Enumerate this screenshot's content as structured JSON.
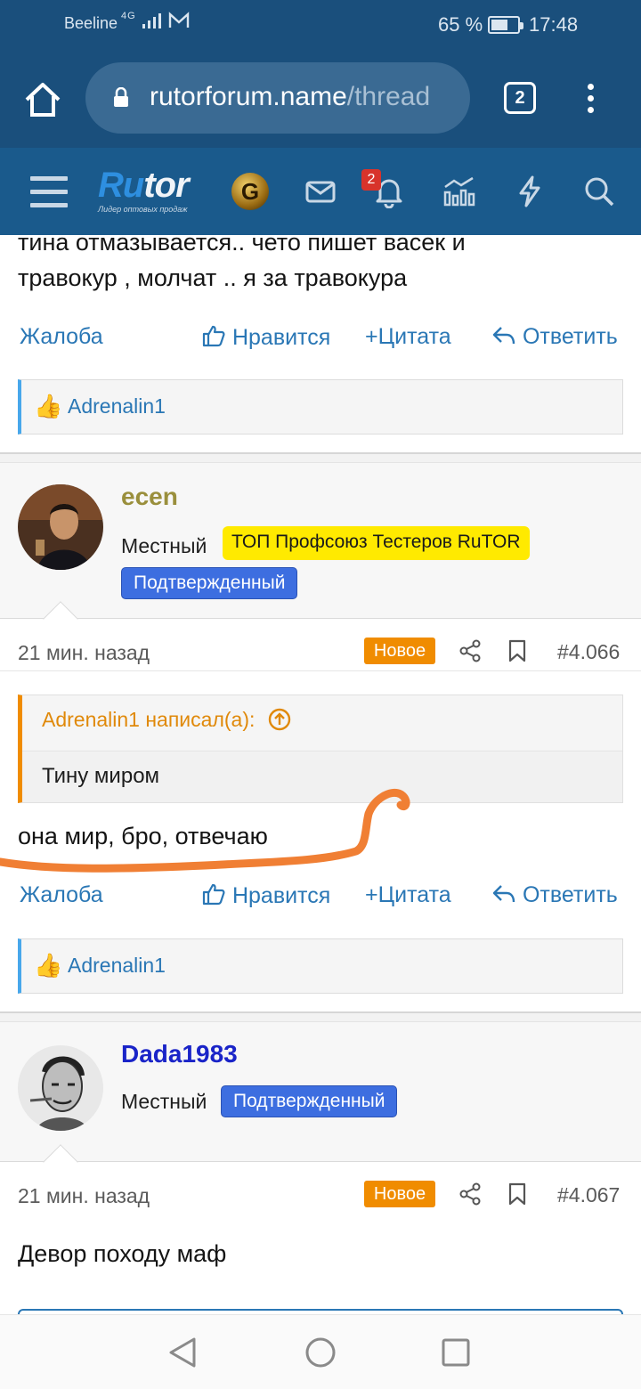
{
  "status_bar": {
    "carrier": "Beeline",
    "network": "4G",
    "battery_percent_text": "65 %",
    "battery_level": 0.65,
    "time": "17:48"
  },
  "browser": {
    "url_host": "rutorforum.name",
    "url_path": "/thread",
    "tab_count": "2"
  },
  "site_header": {
    "logo_text_a": "Ru",
    "logo_text_b": "tor",
    "logo_subtitle": "Лидер оптовых продаж",
    "badge_letter": "G",
    "notification_count": "2",
    "icons": [
      "menu-icon",
      "envelope-icon",
      "bell-icon",
      "stats-icon",
      "lightning-icon",
      "search-icon"
    ]
  },
  "posts": {
    "prev": {
      "text_line1": "тина отмазывается.. чето пишет васек и",
      "text_line2": "травокур , молчат .. я за травокура",
      "report": "Жалоба",
      "like": "Нравится",
      "quote": "Цитата",
      "reply": "Ответить",
      "liked_by": "Adrenalin1"
    },
    "ecen": {
      "username": "ecen",
      "username_color": "#9a8f3c",
      "role": "Местный",
      "badge_top": "ТОП Профсоюз Тестеров RuTOR",
      "badge_verified": "Подтвержденный",
      "time": "21 мин. назад",
      "new_label": "Новое",
      "post_number": "#4.066",
      "quote_author": "Adrenalin1 написал(а):",
      "quote_text": "Тину миром",
      "text": "она мир, бро, отвечаю",
      "report": "Жалоба",
      "like": "Нравится",
      "quote": "Цитата",
      "reply": "Ответить",
      "liked_by": "Adrenalin1"
    },
    "dada": {
      "username": "Dada1983",
      "username_color": "#1a24c8",
      "role": "Местный",
      "badge_verified": "Подтвержденный",
      "time": "21 мин. назад",
      "new_label": "Новое",
      "post_number": "#4.067",
      "text": "Девор походу маф"
    }
  },
  "colors": {
    "header_bg": "#1a4f7c",
    "link": "#2a77b5",
    "new_badge": "#f08c00",
    "annotation_stroke": "#f07f34"
  }
}
